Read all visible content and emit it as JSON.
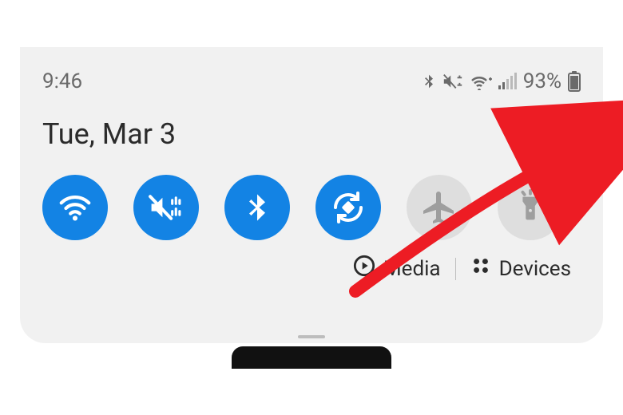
{
  "status": {
    "time": "9:46",
    "battery_text": "93%"
  },
  "date": "Tue, Mar 3",
  "bottom": {
    "media_label": "Media",
    "devices_label": "Devices"
  },
  "icons": {
    "bluetooth": "bluetooth-icon",
    "vibrate": "vibrate-mute-icon",
    "wifi": "wifi-icon",
    "signal": "signal-icon",
    "battery": "battery-icon",
    "power": "power-icon",
    "settings": "gear-icon",
    "play": "play-icon",
    "devices": "grid-icon",
    "airplane": "airplane-icon",
    "flashlight": "flashlight-icon",
    "rotate": "rotate-icon"
  },
  "colors": {
    "accent": "#1383e4",
    "tile_off": "#dedede",
    "arrow": "#ed1c24"
  },
  "tiles": [
    {
      "name": "wifi",
      "on": true
    },
    {
      "name": "sound-vibrate",
      "on": true
    },
    {
      "name": "bluetooth",
      "on": true
    },
    {
      "name": "auto-rotate",
      "on": true
    },
    {
      "name": "airplane",
      "on": false
    },
    {
      "name": "flashlight",
      "on": false
    }
  ]
}
